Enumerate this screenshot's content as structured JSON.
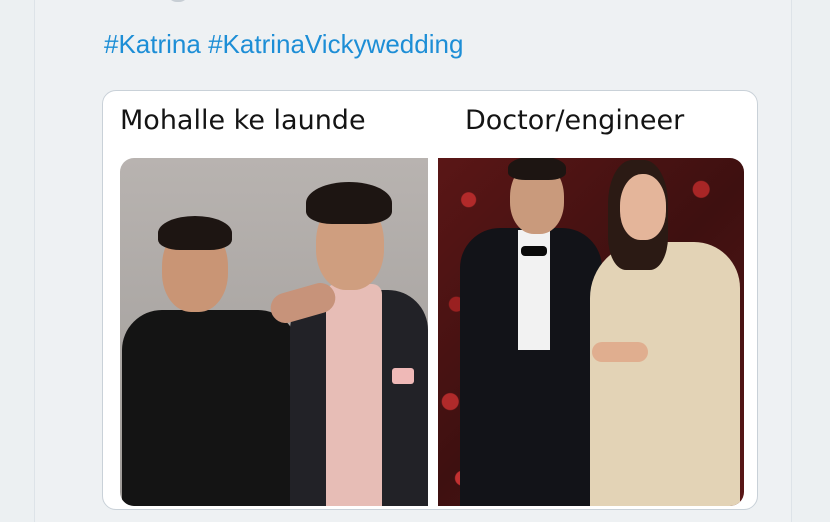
{
  "tweet": {
    "hashtags": [
      "#Katrina",
      "#KatrinaVickywedding"
    ]
  },
  "media": {
    "captions": {
      "left": "Mohalle ke launde",
      "right": "Doctor/engineer"
    }
  },
  "colors": {
    "link": "#1d8ed6",
    "background": "#ecf0f2",
    "card_border": "#c9d1d8"
  }
}
